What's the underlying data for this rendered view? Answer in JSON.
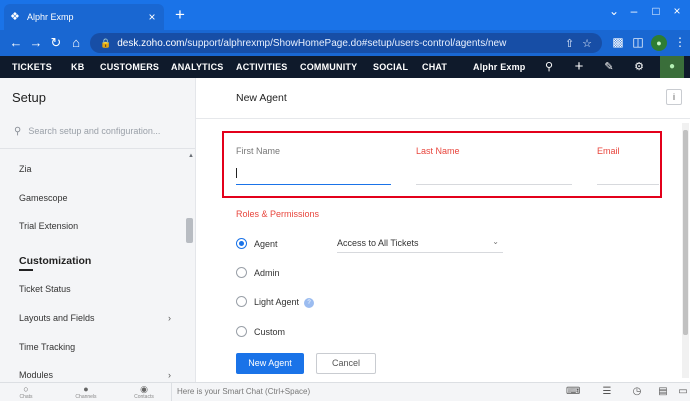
{
  "browser": {
    "tab_title": "Alphr Exmp",
    "url_host": "desk.zoho.com",
    "url_path": "/support/alphrexmp/ShowHomePage.do#setup/users-control/agents/new"
  },
  "appbar": {
    "items": [
      "TICKETS",
      "KB",
      "CUSTOMERS",
      "ANALYTICS",
      "ACTIVITIES",
      "COMMUNITY",
      "SOCIAL",
      "CHAT"
    ],
    "portal": "Alphr Exmp"
  },
  "sidebar": {
    "title": "Setup",
    "search_placeholder": "Search setup and configuration...",
    "items_top": [
      "Zia",
      "Gamescope",
      "Trial Extension"
    ],
    "section_heading": "Customization",
    "items_bottom": [
      "Ticket Status",
      "Layouts and Fields",
      "Time Tracking",
      "Modules"
    ]
  },
  "main": {
    "title": "New Agent",
    "info_label": "i",
    "fields": {
      "first_name": "First Name",
      "last_name": "Last Name",
      "email": "Email"
    },
    "roles_label": "Roles & Permissions",
    "roles": [
      "Agent",
      "Admin",
      "Light Agent",
      "Custom"
    ],
    "selected_role": "Agent",
    "ticket_access": "Access to All Tickets",
    "primary_button": "New Agent",
    "secondary_button": "Cancel"
  },
  "bottombar": {
    "items": [
      "Chats",
      "Channels",
      "Contacts"
    ],
    "smartchat_placeholder": "Here is your Smart Chat (Ctrl+Space)"
  },
  "colors": {
    "browser_blue": "#1a73e8",
    "appbar_bg": "#0f1a2b",
    "highlight_red": "#e3001b",
    "required_label": "#e8453c",
    "primary": "#1a73e8"
  }
}
